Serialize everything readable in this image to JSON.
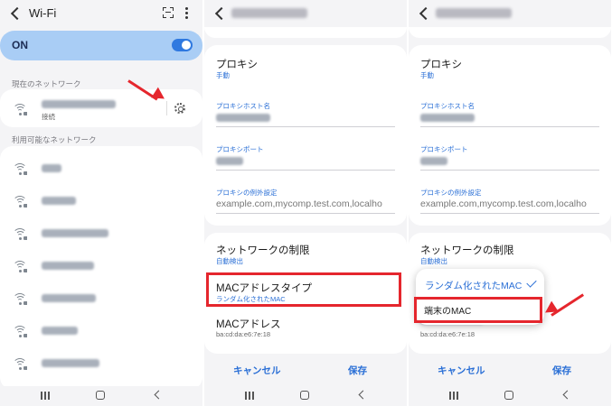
{
  "panel1": {
    "title": "Wi-Fi",
    "toggle_label": "ON",
    "toggle_on": true,
    "current_network_heading": "現在のネットワーク",
    "current_network_status": "接続",
    "available_networks_heading": "利用可能なネットワーク",
    "available_network_count": 7,
    "icons": [
      "back-icon",
      "qr-scan-icon",
      "more-options-icon",
      "wifi-icon",
      "gear-icon"
    ]
  },
  "panel2": {
    "proxy_label": "プロキシ",
    "proxy_value": "手動",
    "proxy_host_label": "プロキシホスト名",
    "proxy_port_label": "プロキシポート",
    "proxy_exclusion_label": "プロキシの例外設定",
    "proxy_exclusion_value": "example.com,mycomp.test.com,localho",
    "network_restriction_label": "ネットワークの制限",
    "network_restriction_value": "自動検出",
    "mac_type_label": "MACアドレスタイプ",
    "mac_type_value": "ランダム化されたMAC",
    "mac_address_label": "MACアドレス",
    "mac_address_value": "ba:cd:da:e6:7e:18",
    "cancel_label": "キャンセル",
    "save_label": "保存"
  },
  "panel3": {
    "proxy_label": "プロキシ",
    "proxy_value": "手動",
    "proxy_host_label": "プロキシホスト名",
    "proxy_port_label": "プロキシポート",
    "proxy_exclusion_label": "プロキシの例外設定",
    "proxy_exclusion_value": "example.com,mycomp.test.com,localho",
    "network_restriction_label": "ネットワークの制限",
    "network_restriction_value": "自動検出",
    "dropdown_option_random": "ランダム化されたMAC",
    "dropdown_option_device": "端末のMAC",
    "mac_address_value": "ba:cd:da:e6:7e:18",
    "cancel_label": "キャンセル",
    "save_label": "保存"
  },
  "colors": {
    "accent_blue": "#2a6fd6",
    "toggle_bg": "#a9cdf5",
    "highlight_red": "#e5262d"
  }
}
